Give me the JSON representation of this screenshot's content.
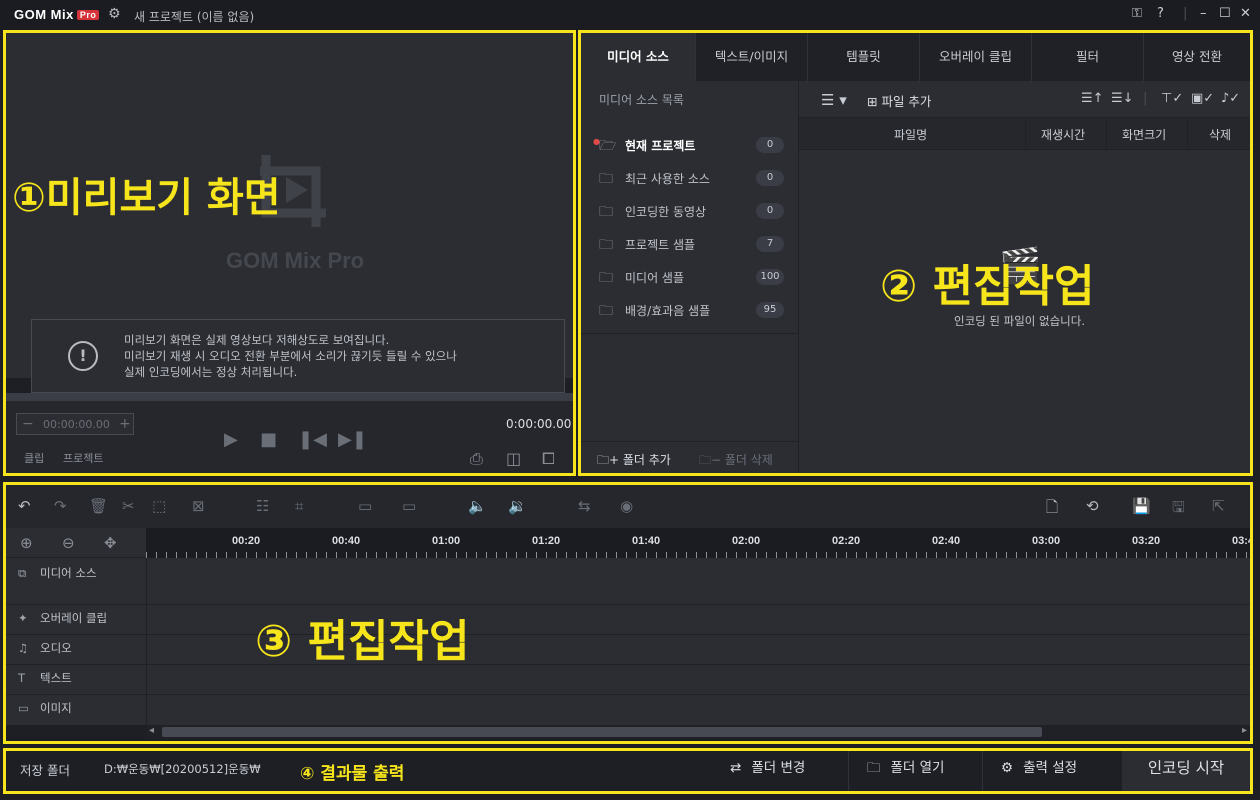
{
  "app": {
    "logo": "GOM Mix",
    "logo_badge": "Pro",
    "project_title": "새 프로젝트 (이름 없음)"
  },
  "window_controls": {
    "key_icon": "⚿",
    "help": "?",
    "minimize": "–",
    "maximize": "☐",
    "close": "✕"
  },
  "annotations": {
    "preview": "①미리보기 화면",
    "media": "② 편집작업",
    "timeline": "③ 편집작업",
    "output": "④ 결과물 출력"
  },
  "preview": {
    "watermark": "GOM Mix Pro",
    "notice_lines": [
      "미리보기 화면은 실제 영상보다 저해상도로 보여집니다.",
      "미리보기 재생 시 오디오 전환 부분에서 소리가 끊기듯 들릴 수 있으나",
      "실제 인코딩에서는 정상 처리됩니다."
    ],
    "timecode": "00:00:00.00",
    "total_time": "0:00:00.00",
    "tabs": {
      "clip": "클립",
      "project": "프로젝트"
    }
  },
  "media_panel": {
    "tabs": [
      "미디어 소스",
      "텍스트/이미지",
      "템플릿",
      "오버레이 클립",
      "필터",
      "영상 전환"
    ],
    "active_tab": 0,
    "source_list_title": "미디어 소스 목록",
    "source_items": [
      {
        "label": "현재 프로젝트",
        "count": "0"
      },
      {
        "label": "최근 사용한 소스",
        "count": "0"
      },
      {
        "label": "인코딩한 동영상",
        "count": "0"
      },
      {
        "label": "프로젝트 샘플",
        "count": "7"
      },
      {
        "label": "미디어 샘플",
        "count": "100"
      },
      {
        "label": "배경/효과음 샘플",
        "count": "95"
      }
    ],
    "folder_add": "폴더 추가",
    "folder_delete": "폴더 삭제",
    "file_add": "파일 추가",
    "columns": [
      "파일명",
      "재생시간",
      "화면크기",
      "삭제"
    ],
    "empty_text": "인코딩 된 파일이 없습니다."
  },
  "timeline": {
    "ticks": [
      "00:20",
      "00:40",
      "01:00",
      "01:20",
      "01:40",
      "02:00",
      "02:20",
      "02:40",
      "03:00",
      "03:20",
      "03:4"
    ],
    "tracks": [
      {
        "icon": "⧉",
        "label": "미디어 소스"
      },
      {
        "icon": "✦",
        "label": "오버레이 클립"
      },
      {
        "icon": "♫",
        "label": "오디오"
      },
      {
        "icon": "T",
        "label": "텍스트"
      },
      {
        "icon": "▭",
        "label": "이미지"
      }
    ]
  },
  "bottom": {
    "save_folder_label": "저장 폴더",
    "save_path": "D:₩운동₩[20200512]운동₩",
    "change_folder": "폴더 변경",
    "open_folder": "폴더 열기",
    "output_settings": "출력 설정",
    "start_encoding": "인코딩 시작"
  }
}
